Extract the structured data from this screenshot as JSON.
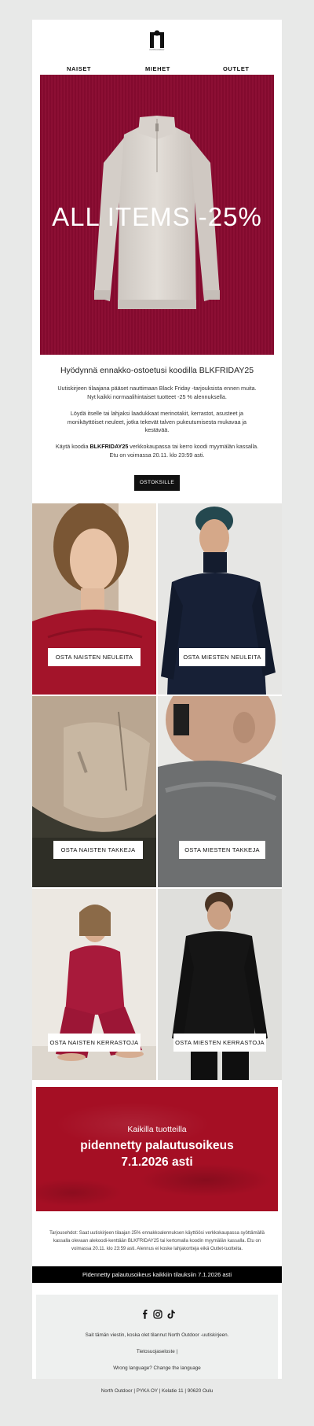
{
  "brand": {
    "logo_text": "northoutdoor"
  },
  "nav": {
    "women": "NAISET",
    "men": "MIEHET",
    "outlet": "OUTLET"
  },
  "hero": {
    "headline": "ALL ITEMS -25%",
    "background": "#8a0a30"
  },
  "promo": {
    "title": "Hyödynnä ennakko-ostoetusi koodilla BLKFRIDAY25",
    "p1_line1": "Uutiskirjeen tilaajana pääset nauttimaan Black Friday -tarjouksista ennen muita.",
    "p1_line2": "Nyt kaikki normaalihintaiset tuotteet -25 % alennuksella.",
    "p2_line1": "Löydä itselle tai lahjaksi laadukkaat merinotakit, kerrastot, asusteet ja",
    "p2_line2": "monikäyttöiset neuleet, jotka tekevät talven pukeutumisesta mukavaa ja",
    "p2_line3": "kestävää.",
    "p3_pre": "Käytä koodia ",
    "p3_code": "BLKFRIDAY25",
    "p3_post": " verkkokaupassa tai kerro koodi myymälän kassalla.",
    "p3_line2": "Etu on voimassa 20.11. klo 23:59 asti.",
    "cta": "OSTOKSILLE"
  },
  "tiles": [
    {
      "label": "OSTA NAISTEN NEULEITA"
    },
    {
      "label": "OSTA MIESTEN NEULEITA"
    },
    {
      "label": "OSTA NAISTEN TAKKEJA"
    },
    {
      "label": "OSTA MIESTEN TAKKEJA"
    },
    {
      "label": "OSTA NAISTEN KERRASTOJA"
    },
    {
      "label": "OSTA MIESTEN KERRASTOJA"
    }
  ],
  "returns_banner": {
    "line1": "Kaikilla tuotteilla",
    "line2": "pidennetty palautusoikeus",
    "line3": "7.1.2026 asti",
    "background": "#a50f24"
  },
  "terms": {
    "line1": "Tarjousehdot: Saat uutiskirjeen tilaajan 25% ennakkoalennuksen käyttöösi verkkokaupassa syöttämällä",
    "line2": "kassalla olevaan alekoodi-kenttään BLKFRIDAY25 tai kertomalla koodin myymälän kassalla. Etu on",
    "line3": "voimassa 20.11. klo 23:59 asti. Alennus ei koske lahjakortteja eikä Outlet-tuotteita."
  },
  "black_bar": "Pidennetty palautusoikeus kaikkiin tilauksiin 7.1.2026 asti",
  "footer": {
    "socials": [
      "facebook-icon",
      "instagram-icon",
      "tiktok-icon"
    ],
    "reason": "Sait tämän viestin, koska olet tilannut North Outdoor -uutiskirjeen.",
    "privacy": "Tietosuojaseloste |",
    "language": "Wrong language? Change the language",
    "address": "North Outdoor | PYKA OY | Kelatie 11 | 90620 Oulu"
  }
}
